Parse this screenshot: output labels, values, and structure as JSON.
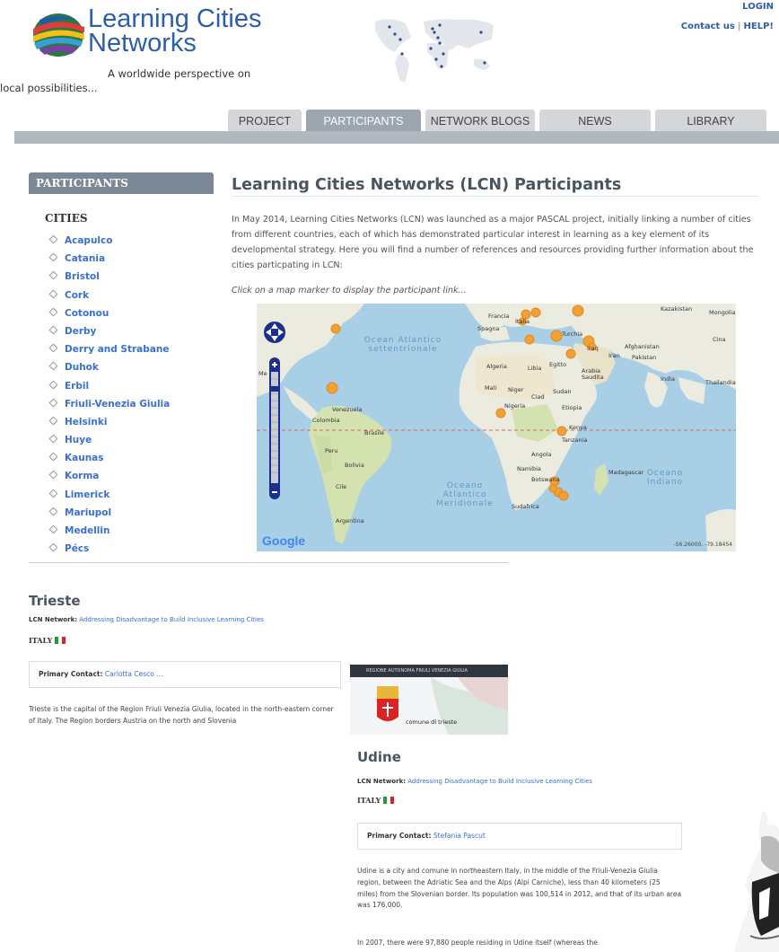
{
  "header": {
    "logo_title_line1": "Learning Cities",
    "logo_title_line2": "Networks",
    "logo_subtitle": "A worldwide perspective on local possibilities...",
    "login": "LOGIN",
    "contact": "Contact us",
    "help": "HELP!"
  },
  "nav": {
    "tabs": [
      {
        "label": "PROJECT",
        "active": false
      },
      {
        "label": "PARTICIPANTS",
        "active": true
      },
      {
        "label": "NETWORK BLOGS",
        "active": false
      },
      {
        "label": "NEWS",
        "active": false
      },
      {
        "label": "LIBRARY",
        "active": false
      }
    ]
  },
  "sidebar": {
    "heading": "PARTICIPANTS",
    "subheading": "CITIES",
    "cities": [
      "Acapulco",
      "Catania",
      "Bristol",
      "Cork",
      "Cotonou",
      "Derby",
      "Derry and Strabane",
      "Duhok",
      "Erbil",
      "Friuli-Venezia Giulia",
      "Helsinki",
      "Huye",
      "Kaunas",
      "Korma",
      "Limerick",
      "Mariupol",
      "Medellin",
      "Pécs"
    ]
  },
  "main": {
    "title": "Learning Cities Networks (LCN) Participants",
    "intro": "In May 2014, Learning Cities Networks (LCN) was launched as a major PASCAL project, initially linking a number of cities from different countries, each of which has demonstrated particular interest in learning as a key element of its developmental strategy.  Here you will find a number of references and resources providing further information about the cities particpating in LCN:",
    "hint": "Click on a map marker to display the participant link..."
  },
  "map": {
    "labels": {
      "kazakistan": "Kazakistan",
      "mongolia": "Mongolia",
      "francia": "Francia",
      "italia": "Italia",
      "spagna": "Spagna",
      "turchia": "Turchia",
      "cina": "Cina",
      "iraq": "Iraq",
      "iran": "Iran",
      "afghanistan": "Afghanistan",
      "pakistan": "Pakistan",
      "algeria": "Algeria",
      "libia": "Libia",
      "egitto": "Egitto",
      "arabia": "Arabia Saudita",
      "india": "India",
      "thailandia": "Thailandia",
      "mali": "Mali",
      "niger": "Niger",
      "ciad": "Ciad",
      "sudan": "Sudan",
      "nigeria": "Nigeria",
      "etiopia": "Etiopia",
      "venezuela": "Venezuela",
      "colombia": "Colombia",
      "kenya": "Kenya",
      "tanzania": "Tanzania",
      "peru": "Peru",
      "brasile": "Brasile",
      "bolivia": "Bolivia",
      "angola": "Angola",
      "namibia": "Namibia",
      "botswana": "Botswana",
      "madagascar": "Madagascar",
      "cile": "Cile",
      "sudafrica": "Sudafrica",
      "argentina": "Argentina",
      "me": "Me"
    },
    "oceans": {
      "atlantic_north": "Ocean Atlantico settentrionale",
      "atlantic_south": "Oceano Atlantico Meridionale",
      "indian": "Oceano Indiano"
    },
    "google": "Google",
    "coords": "-56.26000, -79.18454"
  },
  "entries": [
    {
      "title": "Trieste",
      "network_label": "LCN Network:",
      "network": "Addressing Disadvantage to Build Inclusive Learning Cities",
      "country": "ITALY",
      "contact_label": "Primary Contact:",
      "contact": "Carlotta Cesco ...",
      "body": "Trieste is the capital of the Region Friuli Venezia Giulia, located in the north-eastern corner of Italy. The Region borders Austria on the north and Slovenia",
      "image_header": "REGIONE AUTONOMA FRIULI VENEZIA GIULIA",
      "image_caption": "comune di trieste"
    },
    {
      "title": "Udine",
      "network_label": "LCN Network:",
      "network": "Addressing Disadvantage to Build Inclusive Learning Cities",
      "country": "ITALY",
      "contact_label": "Primary Contact:",
      "contact": "Stefania Pascut",
      "body": "Udine is a city and comune in northeastern Italy, in the middle of the Friuli-Venezia Giulia region, between the Adriatic Sea and the Alps (Alpi Carniche), less than 40 kilometers (25 miles) from the Slovenian border. Its population was 100,514 in 2012, and that of its urban area was 176,000.",
      "body2": "In 2007, there were 97,880 people residing in Udine itself (whereas the"
    }
  ],
  "colors": {
    "accent": "#3a6fd6",
    "nav_active": "#9ba6b1",
    "nav_inactive": "#d4d6d9",
    "sidebar_head": "#7b8896",
    "marker": "#f2a033"
  }
}
